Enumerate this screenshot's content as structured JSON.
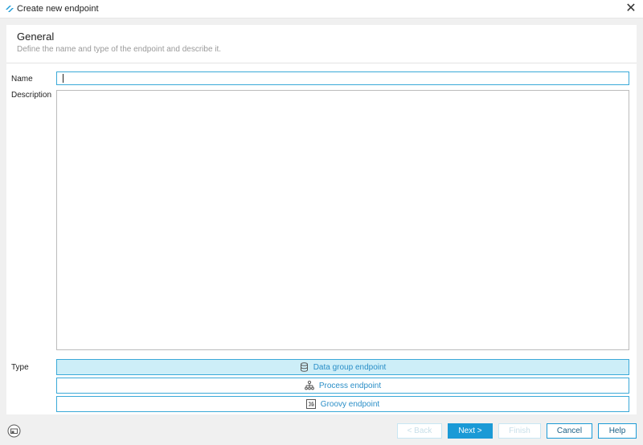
{
  "window": {
    "title": "Create new endpoint"
  },
  "header": {
    "title": "General",
    "subtitle": "Define the name and type of the endpoint and describe it."
  },
  "form": {
    "name_label": "Name",
    "name_value": "",
    "description_label": "Description",
    "description_value": "",
    "type_label": "Type",
    "types": [
      {
        "label": "Data group endpoint",
        "icon": "database-icon",
        "selected": true
      },
      {
        "label": "Process endpoint",
        "icon": "process-hierarchy-icon",
        "selected": false
      },
      {
        "label": "Groovy endpoint",
        "icon": "groovy-icon",
        "selected": false
      }
    ]
  },
  "footer": {
    "back_label": "< Back",
    "next_label": "Next >",
    "finish_label": "Finish",
    "cancel_label": "Cancel",
    "help_label": "Help"
  },
  "colors": {
    "accent": "#1b9ad6",
    "selected_bg": "#cdeef8",
    "link_text": "#2a8ec7"
  }
}
